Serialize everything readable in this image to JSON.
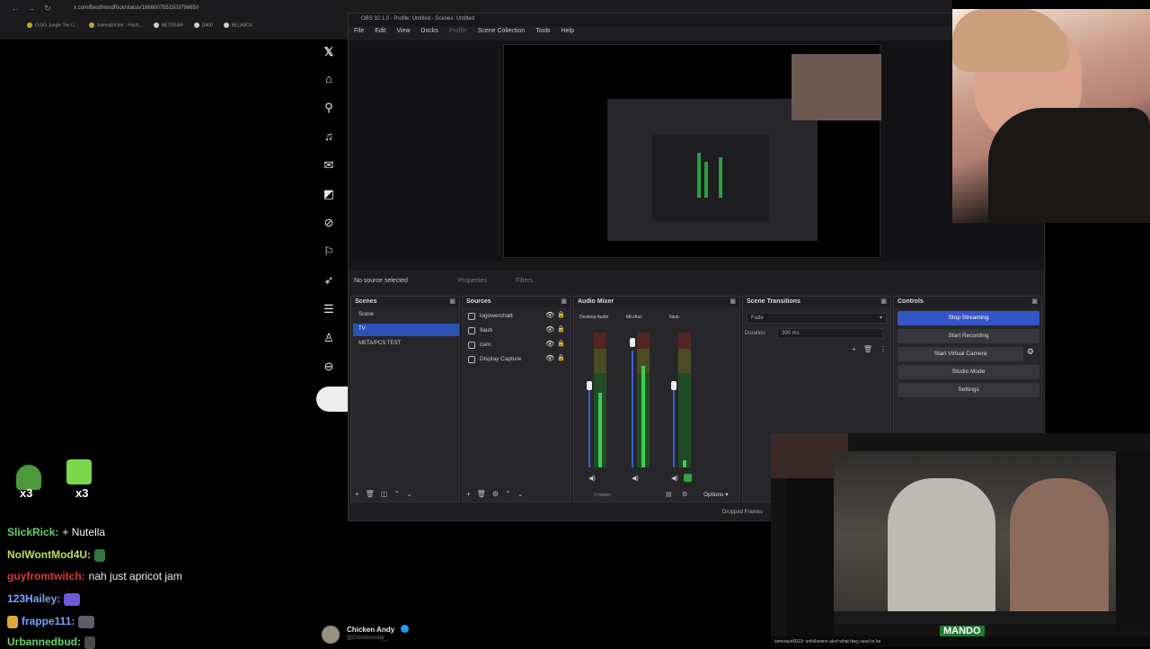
{
  "browser": {
    "url": "x.com/BestfriendRick/status/1866007551503798650",
    "bookmarks": [
      "O.GG Jungle Tier Li...",
      "balenaEtcher - Flash...",
      "NETGEAR",
      "D400",
      "BELABOX"
    ]
  },
  "obs": {
    "title": "OBS 32.1.0 - Profile: Untitled - Scenes: Untitled",
    "menu": [
      "File",
      "Edit",
      "View",
      "Docks",
      "Profile",
      "Scene Collection",
      "Tools",
      "Help"
    ],
    "no_source": "No source selected",
    "properties_tab": "Properties",
    "filters_tab": "Filters",
    "docks": {
      "scenes_title": "Scenes",
      "sources_title": "Sources",
      "mixer_title": "Audio Mixer",
      "transitions_title": "Scene Transitions",
      "controls_title": "Controls"
    },
    "scenes": [
      "Scene",
      "TV",
      "META/PCS TEST"
    ],
    "sources": [
      "logowerchatt",
      "Ilaub",
      "cam",
      "Display Capture"
    ],
    "mixer": {
      "channels": [
        "Desktop Audio",
        "Mic/Aux",
        "Ilaub"
      ],
      "options_label": "Options",
      "hidden_label": "0 hidden",
      "levels": [
        0.55,
        0.75,
        0.05
      ]
    },
    "transitions": {
      "selected": "Fade",
      "duration_label": "Duration",
      "duration_value": "300 ms"
    },
    "controls": [
      "Stop Streaming",
      "Start Recording",
      "Start Virtual Camera",
      "Studio Mode",
      "Settings"
    ],
    "dropped_frames": "Dropped Frames"
  },
  "chat": {
    "emote_multiplier": [
      "x3",
      "x3"
    ],
    "messages": [
      {
        "name": "SlickRick:",
        "text": "+ Nutella",
        "color": "#63d46b"
      },
      {
        "name": "NoIWontMod4U:",
        "text": "",
        "color": "#b8e05a"
      },
      {
        "name": "guyfromtwitch:",
        "text": "nah just apricot jam",
        "color": "#d83a3a"
      },
      {
        "name": "123Hailey:",
        "text": "",
        "color": "#7aa2ff"
      },
      {
        "name": "frappe111:",
        "text": "",
        "color": "#7aa2ff"
      },
      {
        "name": "Urbannedbud:",
        "text": "",
        "color": "#63d46b"
      }
    ]
  },
  "stream": {
    "mando": "MANDO",
    "bottom_text": "iamerace0019: onfollowers alert what they used to be"
  },
  "tweet": {
    "author_name": "Chicken Andy",
    "author_handle": "@ChickenAndy_"
  }
}
